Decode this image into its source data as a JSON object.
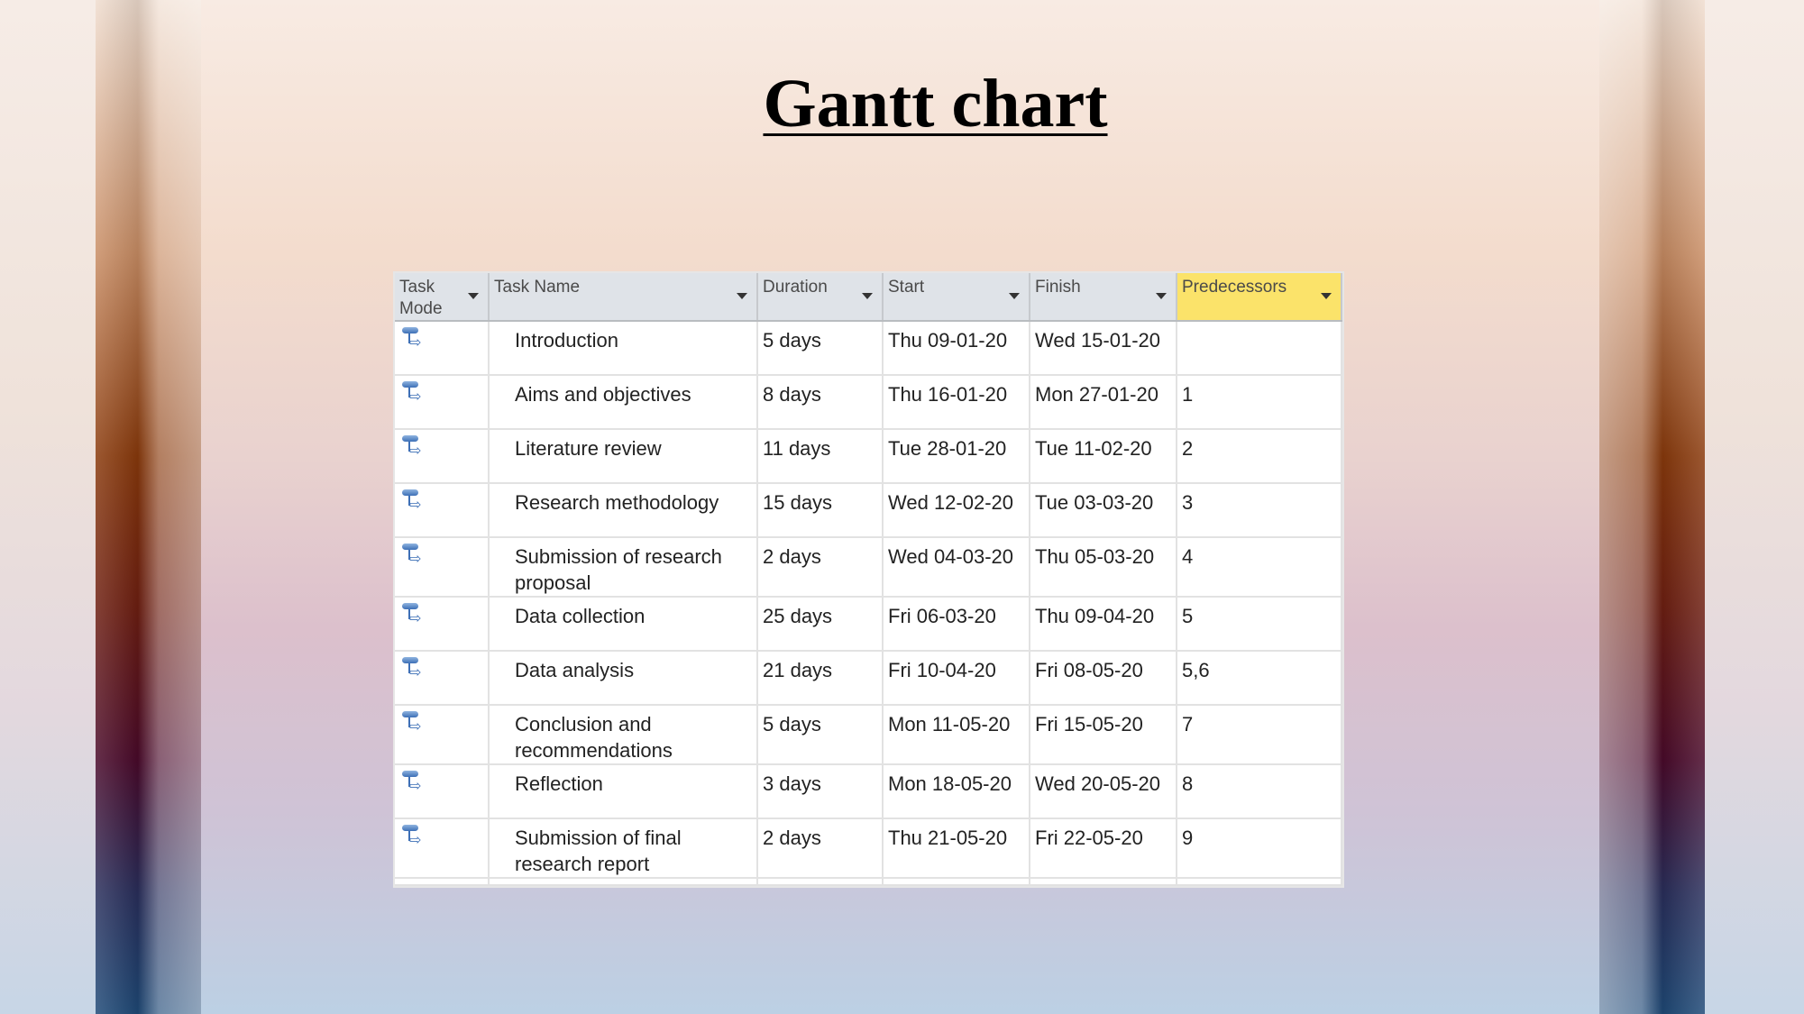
{
  "title": "Gantt chart",
  "table": {
    "headers": {
      "task_mode": "Task Mode",
      "task_name": "Task Name",
      "duration": "Duration",
      "start": "Start",
      "finish": "Finish",
      "predecessors": "Predecessors"
    },
    "highlight_color": "#fbe36a",
    "task_mode_icon": "auto-scheduled-task-icon",
    "rows": [
      {
        "name": "Introduction",
        "duration": "5 days",
        "start": "Thu 09-01-20",
        "finish": "Wed 15-01-20",
        "predecessors": ""
      },
      {
        "name": "Aims and objectives",
        "duration": "8 days",
        "start": "Thu 16-01-20",
        "finish": "Mon 27-01-20",
        "predecessors": "1"
      },
      {
        "name": "Literature review",
        "duration": "11 days",
        "start": "Tue 28-01-20",
        "finish": "Tue 11-02-20",
        "predecessors": "2"
      },
      {
        "name": "Research methodology",
        "duration": "15 days",
        "start": "Wed 12-02-20",
        "finish": "Tue 03-03-20",
        "predecessors": "3"
      },
      {
        "name": "Submission of research proposal",
        "duration": "2 days",
        "start": "Wed 04-03-20",
        "finish": "Thu 05-03-20",
        "predecessors": "4"
      },
      {
        "name": "Data collection",
        "duration": "25 days",
        "start": "Fri 06-03-20",
        "finish": "Thu 09-04-20",
        "predecessors": "5"
      },
      {
        "name": "Data analysis",
        "duration": "21 days",
        "start": "Fri 10-04-20",
        "finish": "Fri 08-05-20",
        "predecessors": "5,6"
      },
      {
        "name": "Conclusion and recommendations",
        "duration": "5 days",
        "start": "Mon 11-05-20",
        "finish": "Fri 15-05-20",
        "predecessors": "7"
      },
      {
        "name": "Reflection",
        "duration": "3 days",
        "start": "Mon 18-05-20",
        "finish": "Wed 20-05-20",
        "predecessors": "8"
      },
      {
        "name": "Submission of final research report",
        "duration": "2 days",
        "start": "Thu 21-05-20",
        "finish": "Fri 22-05-20",
        "predecessors": "9"
      }
    ]
  }
}
